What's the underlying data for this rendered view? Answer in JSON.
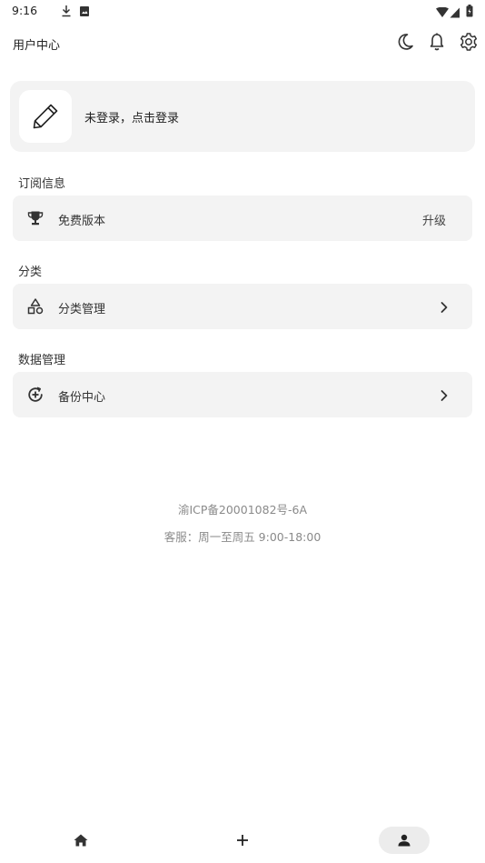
{
  "status_bar": {
    "time": "9:16",
    "left_icons": [
      "download-icon",
      "image-notification-icon"
    ],
    "right_icons": [
      "wifi-icon",
      "signal-icon",
      "battery-icon"
    ]
  },
  "header": {
    "title": "用户中心",
    "actions": [
      "moon-icon",
      "bell-icon",
      "gear-icon"
    ]
  },
  "login_card": {
    "avatar_icon": "pencil-icon",
    "text": "未登录，点击登录"
  },
  "sections": {
    "subscription": {
      "label": "订阅信息",
      "row_icon": "trophy-icon",
      "row_label": "免费版本",
      "row_action": "升级"
    },
    "category": {
      "label": "分类",
      "row_icon": "shapes-icon",
      "row_label": "分类管理"
    },
    "data": {
      "label": "数据管理",
      "row_icon": "backup-icon",
      "row_label": "备份中心"
    }
  },
  "footer": {
    "icp": "渝ICP备20001082号-6A",
    "service": "客服：周一至周五 9:00-18:00"
  },
  "bottom_nav": {
    "items": [
      "home-icon",
      "add-icon",
      "person-icon"
    ],
    "active": "person-icon"
  }
}
